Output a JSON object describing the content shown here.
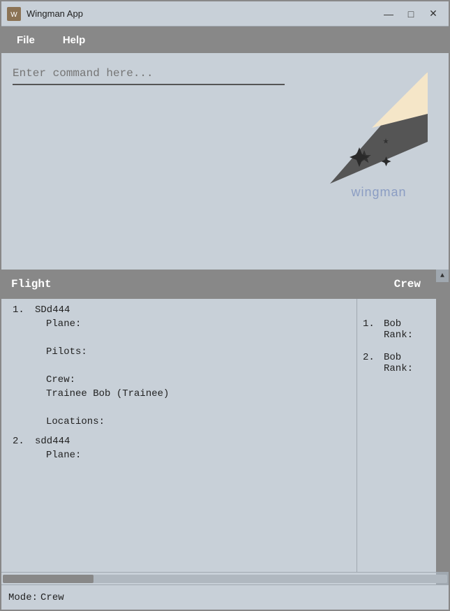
{
  "window": {
    "title": "Wingman App",
    "icon": "W",
    "controls": {
      "minimize": "—",
      "maximize": "□",
      "close": "✕"
    }
  },
  "menu": {
    "items": [
      {
        "label": "File"
      },
      {
        "label": "Help"
      }
    ]
  },
  "command": {
    "placeholder": "Enter command here...",
    "value": ""
  },
  "logo": {
    "text_plain": "wing",
    "text_accent": "man"
  },
  "table": {
    "header": {
      "flight": "Flight",
      "crew": "Crew"
    }
  },
  "flights": [
    {
      "number": "1.",
      "id": "SDd444",
      "plane_label": "Plane:",
      "plane_value": "",
      "pilots_label": "Pilots:",
      "pilots_value": "",
      "crew_label": "Crew:",
      "crew_value": "Trainee Bob (Trainee)",
      "locations_label": "Locations:",
      "locations_value": ""
    },
    {
      "number": "2.",
      "id": "sdd444",
      "plane_label": "Plane:",
      "plane_value": "",
      "pilots_label": "",
      "pilots_value": "",
      "crew_label": "",
      "crew_value": "",
      "locations_label": "",
      "locations_value": ""
    }
  ],
  "crew_list": [
    {
      "number": "1.",
      "name": "Bob",
      "rank": "Rank:"
    },
    {
      "number": "2.",
      "name": "Bob",
      "rank": "Rank:"
    }
  ],
  "status": {
    "label": "Mode:",
    "value": "Crew"
  }
}
